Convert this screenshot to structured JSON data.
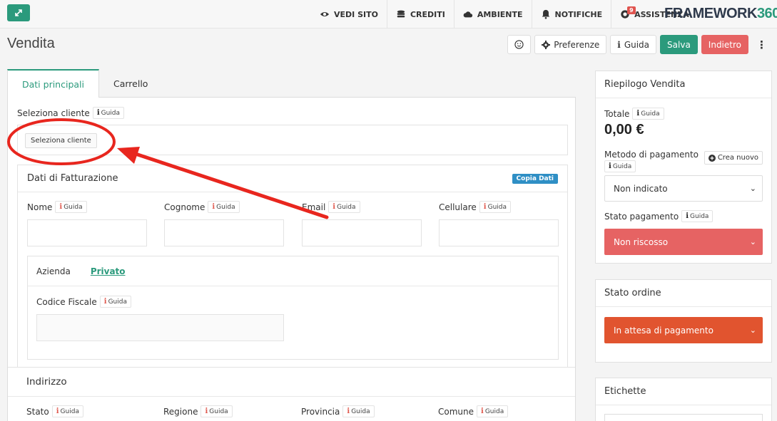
{
  "topbar": {
    "nav": [
      {
        "label": "VEDI SITO",
        "icon": "eye-icon"
      },
      {
        "label": "CREDITI",
        "icon": "coins-icon"
      },
      {
        "label": "AMBIENTE",
        "icon": "cloud-icon"
      },
      {
        "label": "NOTIFICHE",
        "icon": "bell-icon"
      },
      {
        "label": "ASSISTENZA",
        "icon": "support-icon",
        "badge": "9"
      }
    ],
    "logo_main": "FRAMEWORK",
    "logo_num": "360"
  },
  "page": {
    "title": "Vendita",
    "toolbar": {
      "preferenze": "Preferenze",
      "guida": "Guida",
      "salva": "Salva",
      "indietro": "Indietro"
    }
  },
  "tabs": [
    "Dati principali",
    "Carrello"
  ],
  "guida_label": "Guida",
  "cliente": {
    "label": "Seleziona cliente",
    "button": "Seleziona cliente"
  },
  "fatturazione": {
    "title": "Dati di Fatturazione",
    "copia": "Copia Dati",
    "fields": [
      "Nome",
      "Cognome",
      "Email",
      "Cellulare"
    ],
    "tipo_tabs": [
      "Azienda",
      "Privato"
    ],
    "codice_fiscale": "Codice Fiscale"
  },
  "indirizzo": {
    "title": "Indirizzo",
    "fields": [
      "Stato",
      "Regione",
      "Provincia",
      "Comune"
    ]
  },
  "riepilogo": {
    "title": "Riepilogo Vendita",
    "totale_label": "Totale",
    "totale_value": "0,00 €",
    "metodo_label": "Metodo di pagamento",
    "crea_nuovo": "Crea nuovo",
    "metodo_value": "Non indicato",
    "stato_pag_label": "Stato pagamento",
    "stato_pag_value": "Non riscosso"
  },
  "stato_ordine": {
    "title": "Stato ordine",
    "value": "In attesa di pagamento"
  },
  "etichette": {
    "title": "Etichette"
  },
  "colors": {
    "accent": "#2b9a7c",
    "danger": "#e66363",
    "warning": "#e1542f",
    "info": "#2f8fc5",
    "annotation": "#e8261e"
  }
}
